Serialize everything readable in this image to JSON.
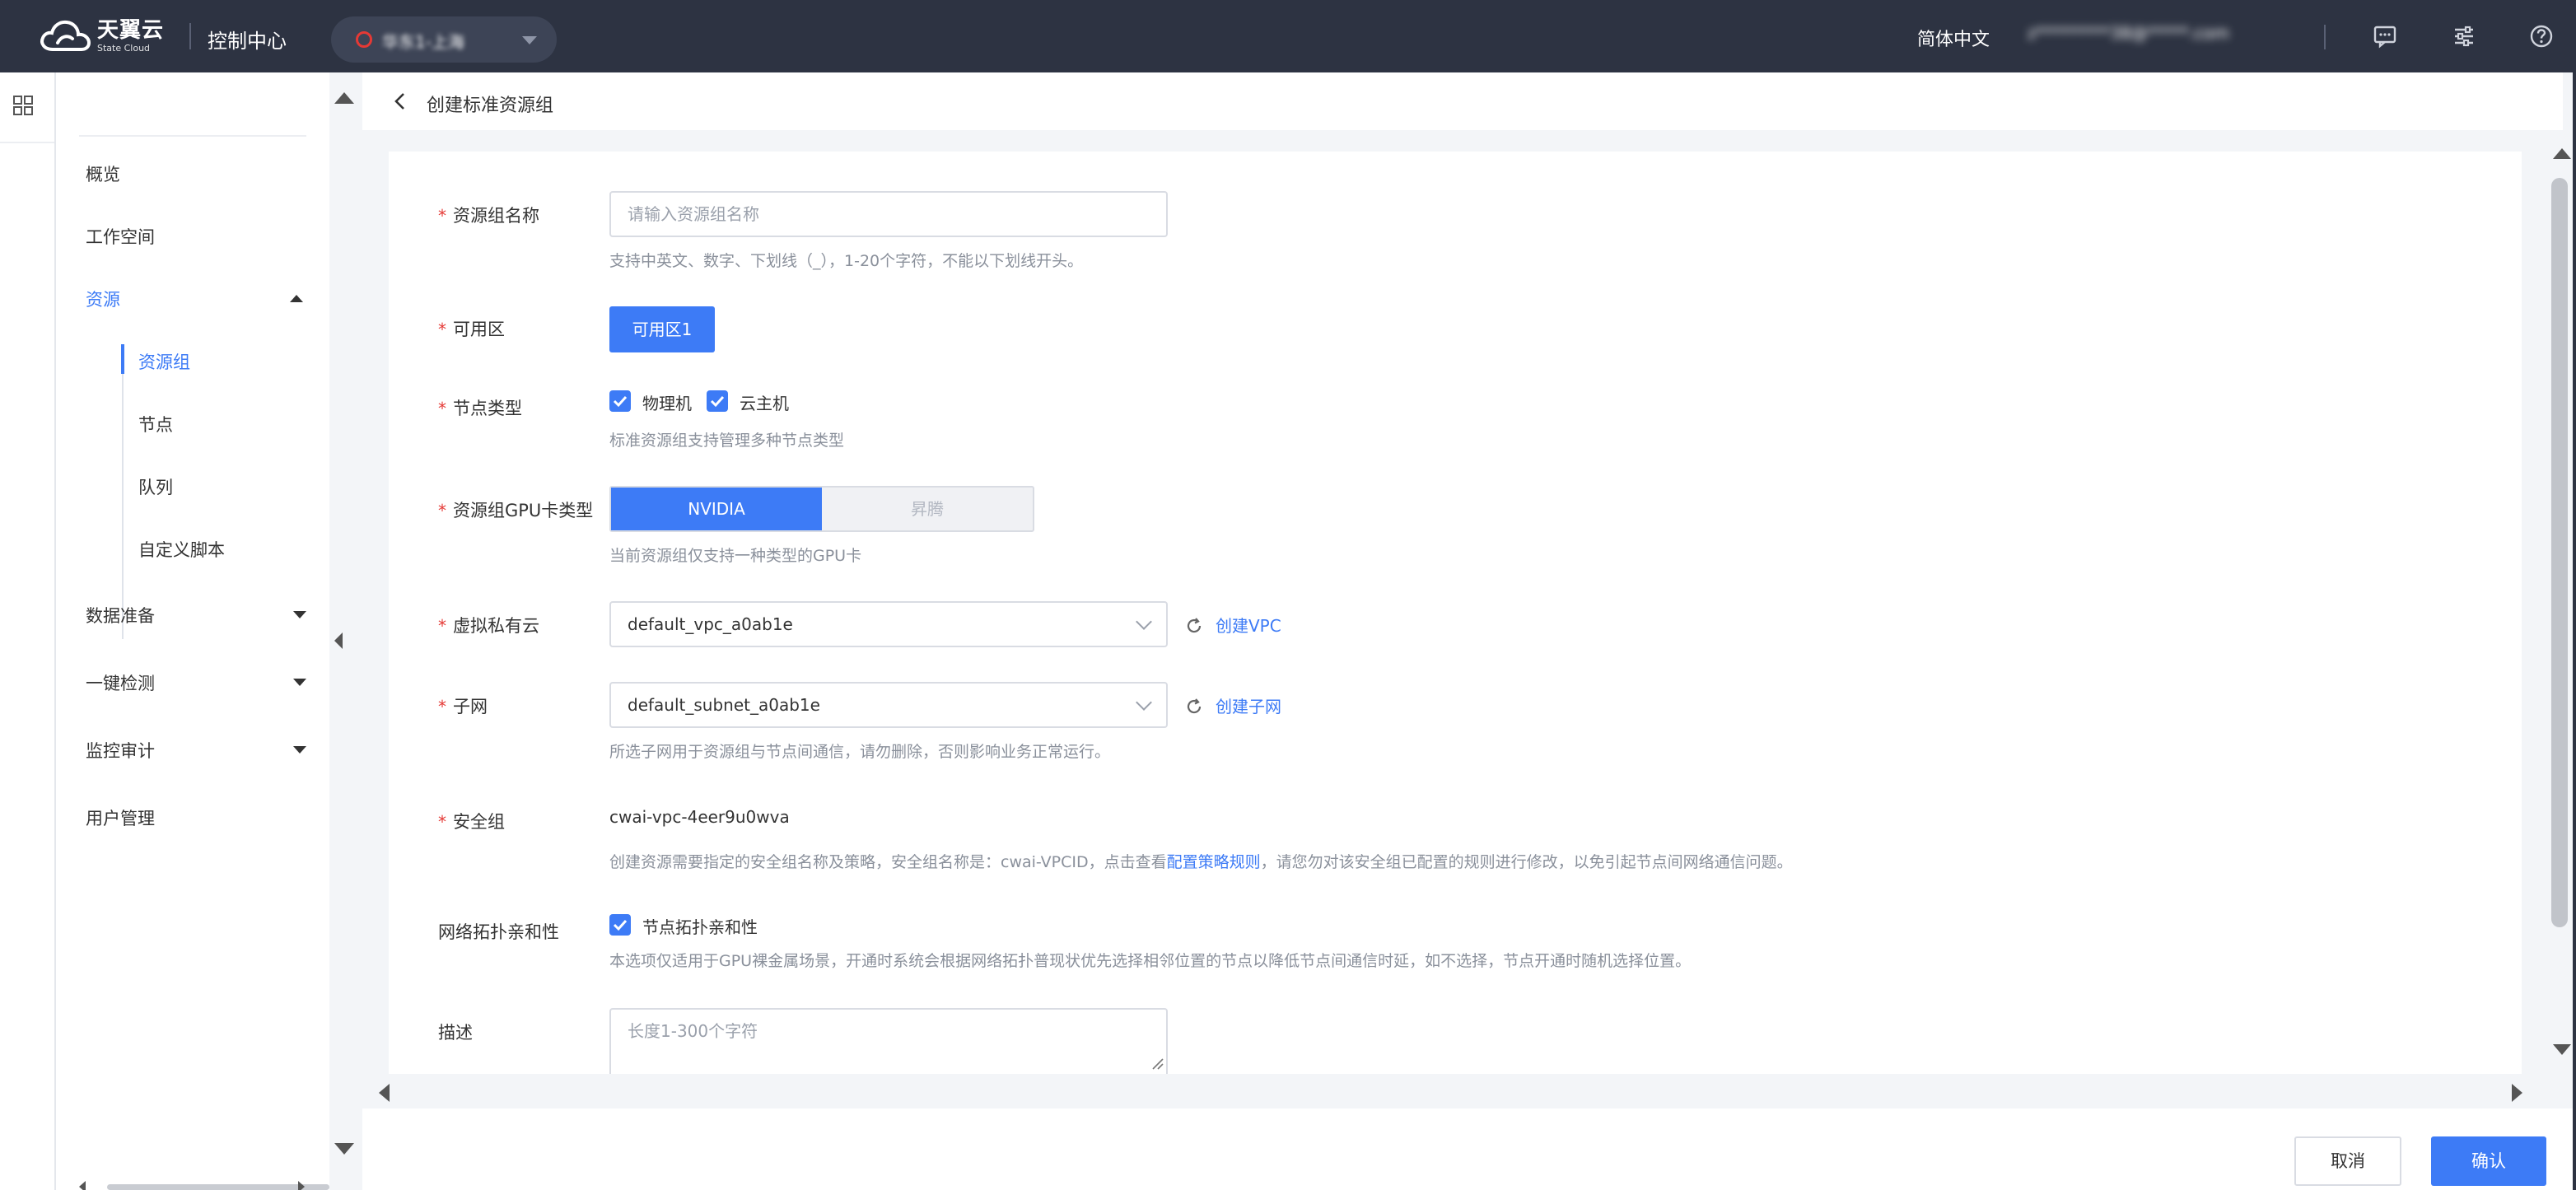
{
  "topbar": {
    "logo_cn": "天翼云",
    "logo_en": "State Cloud",
    "console_title": "控制中心",
    "region": "华东1-上海",
    "language": "简体中文",
    "user": "z*********38@*****.com",
    "icons": [
      "message-icon",
      "settings-sliders-icon",
      "help-icon"
    ]
  },
  "nav": {
    "items": {
      "overview": "概览",
      "workspace": "工作空间",
      "resources": "资源",
      "resource_group": "资源组",
      "node": "节点",
      "queue": "队列",
      "custom_script": "自定义脚本",
      "data_prep": "数据准备",
      "one_click_check": "一键检测",
      "monitor_audit": "监控审计",
      "user_mgmt": "用户管理"
    }
  },
  "header": {
    "title": "创建标准资源组"
  },
  "form": {
    "name": {
      "label": "资源组名称",
      "placeholder": "请输入资源组名称",
      "hint": "支持中英文、数字、下划线（_），1-20个字符，不能以下划线开头。"
    },
    "zone": {
      "label": "可用区",
      "option": "可用区1"
    },
    "node_type": {
      "label": "节点类型",
      "opt1": "物理机",
      "opt2": "云主机",
      "hint": "标准资源组支持管理多种节点类型"
    },
    "gpu_type": {
      "label": "资源组GPU卡类型",
      "opt1": "NVIDIA",
      "opt2": "昇腾",
      "hint": "当前资源组仅支持一种类型的GPU卡"
    },
    "vpc": {
      "label": "虚拟私有云",
      "value": "default_vpc_a0ab1e",
      "link": "创建VPC"
    },
    "subnet": {
      "label": "子网",
      "value": "default_subnet_a0ab1e",
      "link": "创建子网",
      "hint": "所选子网用于资源组与节点间通信，请勿删除，否则影响业务正常运行。"
    },
    "security_group": {
      "label": "安全组",
      "value": "cwai-vpc-4eer9u0wva",
      "hint_pre": "创建资源需要指定的安全组名称及策略，安全组名称是：cwai-VPCID，点击查看",
      "hint_link": "配置策略规则",
      "hint_post": "，请您勿对该安全组已配置的规则进行修改，以免引起节点间网络通信问题。"
    },
    "topology": {
      "label": "网络拓扑亲和性",
      "option": "节点拓扑亲和性",
      "hint": "本选项仅适用于GPU裸金属场景，开通时系统会根据网络拓扑普现状优先选择相邻位置的节点以降低节点间通信时延，如不选择，节点开通时随机选择位置。"
    },
    "description": {
      "label": "描述",
      "placeholder": "长度1-300个字符"
    }
  },
  "footer": {
    "cancel": "取消",
    "confirm": "确认"
  },
  "colors": {
    "topbar_bg": "#2d3342",
    "accent": "#3d7bf6",
    "required": "#e53935"
  }
}
